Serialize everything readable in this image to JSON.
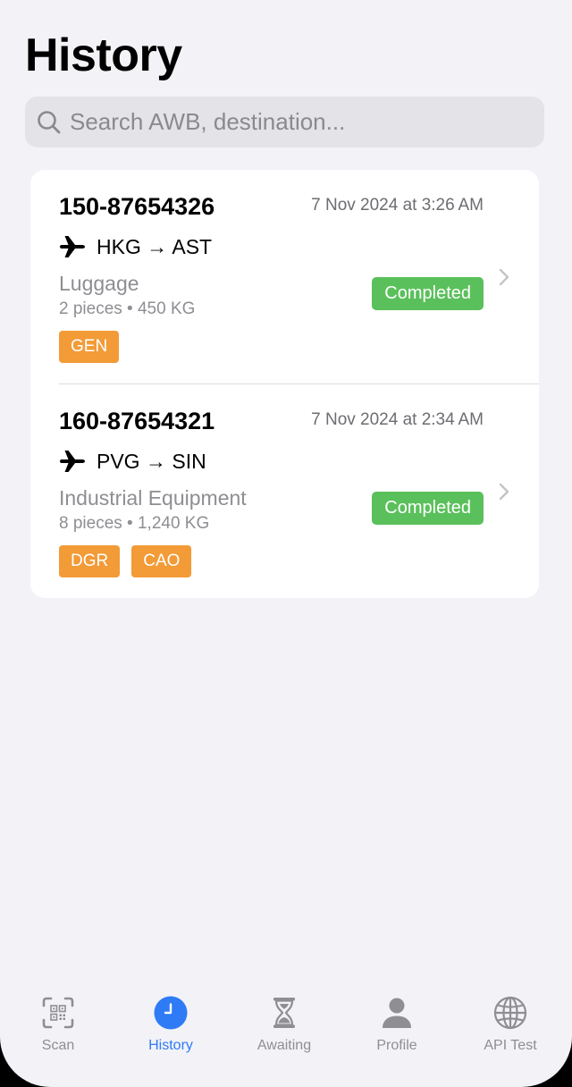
{
  "header": {
    "title": "History"
  },
  "search": {
    "placeholder": "Search AWB, destination..."
  },
  "shipments": [
    {
      "awb": "150-87654326",
      "date": "7 Nov 2024 at 3:26 AM",
      "route": "HKG → AST",
      "goods": "Luggage",
      "meta": "2 pieces • 450 KG",
      "status": "Completed",
      "tags": [
        "GEN"
      ]
    },
    {
      "awb": "160-87654321",
      "date": "7 Nov 2024 at 2:34 AM",
      "route": "PVG → SIN",
      "goods": "Industrial Equipment",
      "meta": "8 pieces • 1,240 KG",
      "status": "Completed",
      "tags": [
        "DGR",
        "CAO"
      ]
    }
  ],
  "tabbar": {
    "active": "History",
    "items": [
      {
        "label": "Scan",
        "icon": "qr-scan-icon"
      },
      {
        "label": "History",
        "icon": "clock-icon"
      },
      {
        "label": "Awaiting",
        "icon": "hourglass-icon"
      },
      {
        "label": "Profile",
        "icon": "person-icon"
      },
      {
        "label": "API Test",
        "icon": "globe-icon"
      }
    ]
  },
  "colors": {
    "background": "#f2f2f7",
    "accent": "#2f7bf5",
    "status_completed": "#5ac05b",
    "tag": "#f29b37",
    "secondary_text": "#8e8e93"
  }
}
